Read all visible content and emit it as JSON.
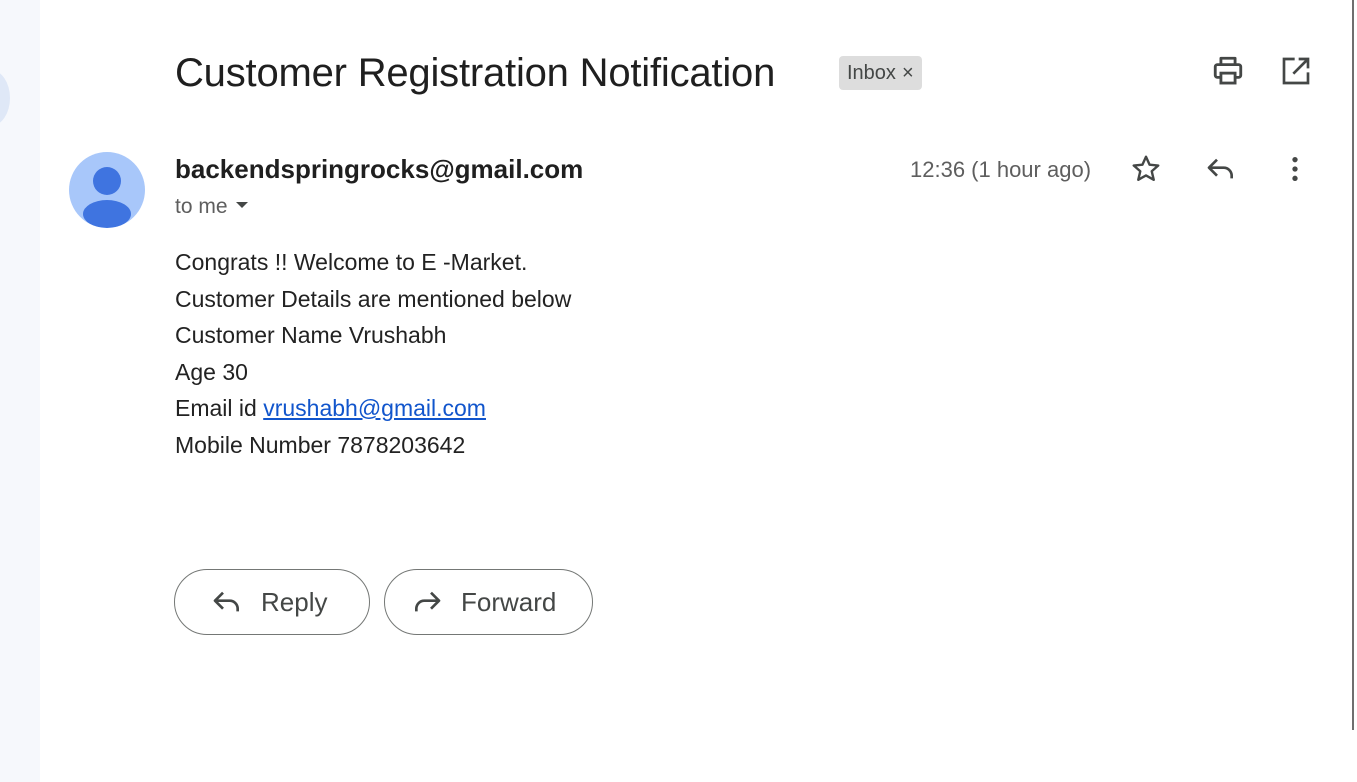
{
  "email": {
    "subject": "Customer Registration Notification",
    "label": "Inbox",
    "label_remove": "×",
    "sender": "backendspringrocks@gmail.com",
    "recipient_summary": "to me",
    "time": "12:36 (1 hour ago)",
    "body_lines": {
      "line1": "Congrats !! Welcome to E -Market.",
      "line2": "Customer Details are mentioned below",
      "line3": "Customer Name Vrushabh",
      "line4": "Age 30",
      "line5_prefix": "Email id ",
      "line5_link": "vrushabh@gmail.com",
      "line6": "Mobile Number 7878203642"
    }
  },
  "actions": {
    "reply_label": "Reply",
    "forward_label": "Forward"
  },
  "icons": {
    "print": "print-icon",
    "open_new_window": "open-in-new-window-icon",
    "star": "star-icon",
    "reply": "reply-icon",
    "more": "more-vert-icon",
    "dropdown": "caret-down-icon",
    "avatar": "default-avatar-icon",
    "forward": "forward-icon"
  },
  "colors": {
    "link": "#1155cc",
    "avatar_bg": "#a8c7fa",
    "avatar_fg": "#3f74e0",
    "chip_bg": "#dddddd",
    "sidebar_bg": "#f6f8fc"
  }
}
